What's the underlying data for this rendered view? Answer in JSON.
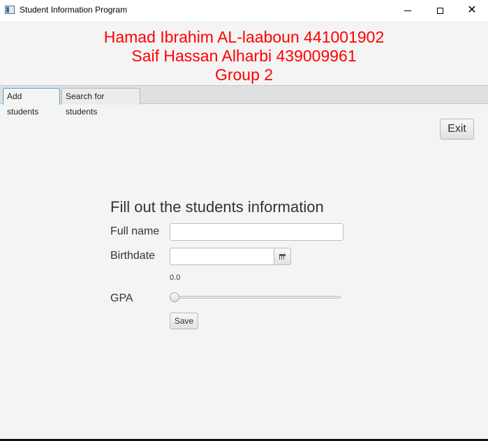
{
  "window": {
    "title": "Student Information Program"
  },
  "header": {
    "line1": "Hamad Ibrahim AL-laaboun 441001902",
    "line2": "Saif Hassan Alharbi 439009961",
    "line3": "Group 2",
    "color": "#ff0000"
  },
  "tabs": [
    {
      "label": "Add students",
      "selected": true
    },
    {
      "label": "Search for students",
      "selected": false
    }
  ],
  "exit_label": "Exit",
  "form": {
    "title": "Fill out the students information",
    "full_name_label": "Full name",
    "full_name_value": "",
    "birthdate_label": "Birthdate",
    "birthdate_value": "",
    "gpa_label": "GPA",
    "gpa_value": "0.0",
    "gpa_slider_level": 0,
    "save_label": "Save"
  },
  "icons": {
    "calendar": "calendar-icon",
    "app": "app-icon",
    "minimize": "minimize-icon",
    "maximize": "maximize-icon",
    "close": "close-icon"
  },
  "colors": {
    "selected_tab_border": "#4a9fd8",
    "background": "#f4f4f4"
  }
}
